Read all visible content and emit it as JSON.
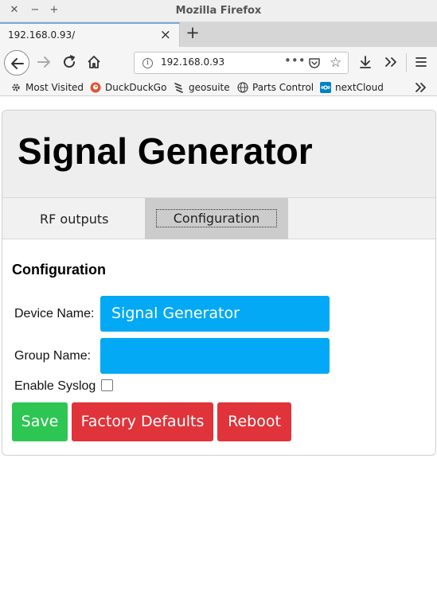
{
  "window": {
    "title": "Mozilla Firefox"
  },
  "browser": {
    "tab_title": "192.168.0.93/",
    "url": "192.168.0.93",
    "url_actions": "•••",
    "bookmarks": [
      {
        "label": "Most Visited",
        "icon": "gear-icon"
      },
      {
        "label": "DuckDuckGo",
        "icon": "duckduckgo-icon"
      },
      {
        "label": "geosuite",
        "icon": "geosuite-icon"
      },
      {
        "label": "Parts Control",
        "icon": "globe-icon"
      },
      {
        "label": "nextCloud",
        "icon": "nextcloud-icon"
      }
    ]
  },
  "page": {
    "title": "Signal Generator",
    "tabs": [
      {
        "label": "RF outputs"
      },
      {
        "label": "Configuration"
      }
    ],
    "section_title": "Configuration",
    "fields": {
      "device_name": {
        "label": "Device Name:",
        "value": "Signal Generator"
      },
      "group_name": {
        "label": "Group Name:",
        "value": ""
      },
      "enable_syslog": {
        "label": "Enable Syslog",
        "checked": false
      }
    },
    "buttons": {
      "save": "Save",
      "factory_defaults": "Factory Defaults",
      "reboot": "Reboot"
    }
  },
  "colors": {
    "input_bg": "#03a9f4",
    "save_bg": "#2dc653",
    "danger_bg": "#e0333a"
  }
}
